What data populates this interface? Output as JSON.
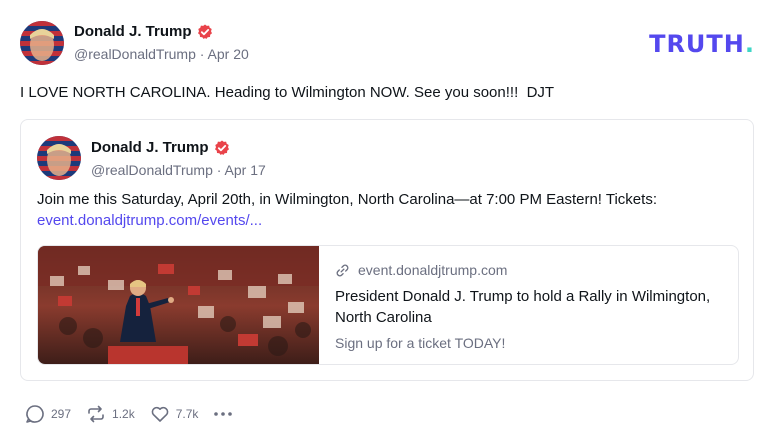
{
  "brand": {
    "logo_text": "TRUTH",
    "logo_dot": ".",
    "colors": {
      "primary": "#5448ee",
      "accent": "#3ed6c6",
      "verified": "#e9434a"
    }
  },
  "post": {
    "author_name": "Donald J. Trump",
    "handle": "@realDonaldTrump",
    "separator": "·",
    "date": "Apr 20",
    "verified_icon": "verified-badge-icon",
    "text": "I LOVE NORTH CAROLINA. Heading to Wilmington NOW. See you soon!!!  DJT"
  },
  "quoted_post": {
    "author_name": "Donald J. Trump",
    "handle": "@realDonaldTrump",
    "separator": "·",
    "date": "Apr 17",
    "text": "Join me this Saturday, April 20th, in Wilmington, North Carolina—at 7:00 PM Eastern! Tickets:",
    "link": "event.donaldjtrump.com/events/...",
    "card": {
      "domain": "event.donaldjtrump.com",
      "title": "President Donald J. Trump to hold a Rally in Wilmington, North Carolina",
      "description": "Sign up for a ticket TODAY!",
      "image_icon": "rally-photo"
    }
  },
  "actions": {
    "replies": "297",
    "retruths": "1.2k",
    "likes": "7.7k",
    "more_icon": "more-dots-icon"
  }
}
